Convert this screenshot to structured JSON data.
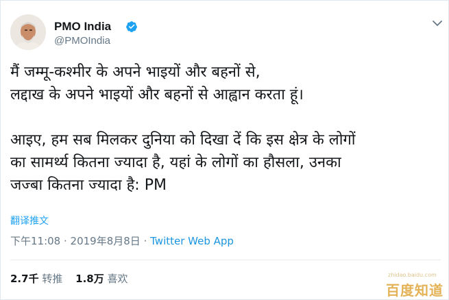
{
  "author": {
    "name": "PMO India",
    "handle": "@PMOIndia",
    "verified": true,
    "verified_color": "#1da1f2"
  },
  "icons": {
    "verified": "verified-badge-icon",
    "menu": "chevron-down-icon",
    "avatar": "avatar"
  },
  "tweet": {
    "lines": [
      "मैं जम्मू-कश्मीर के अपने भाइयों और बहनों से,",
      "लद्दाख के अपने भाइयों और बहनों से आह्वान करता हूं।",
      "",
      "आइए, हम सब मिलकर दुनिया को दिखा दें कि इस क्षेत्र के लोगों",
      "का सामर्थ्य कितना ज्यादा है, यहां के लोगों का हौसला, उनका",
      "जज्बा कितना ज्यादा है: PM"
    ]
  },
  "translate_label": "翻译推文",
  "meta": {
    "time": "下午11:08",
    "separator": " · ",
    "date": "2019年8月8日",
    "app": "Twitter Web App"
  },
  "stats": {
    "retweets_count": "2.7千",
    "retweets_label": "转推",
    "likes_count": "1.8万",
    "likes_label": "喜欢"
  },
  "watermark": {
    "text": "百度知道",
    "subtext": "zhidao.baidu.com"
  },
  "colors": {
    "link": "#1da1f2",
    "muted": "#657786",
    "text": "#14171a"
  }
}
